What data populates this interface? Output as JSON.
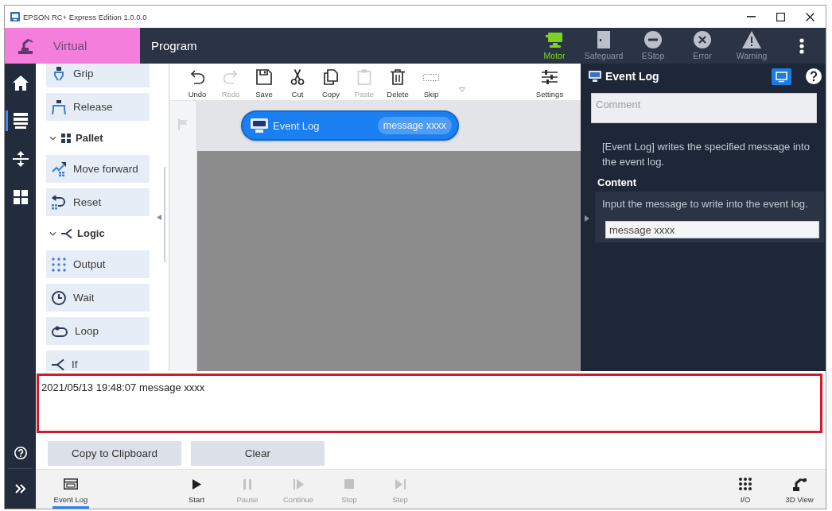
{
  "window": {
    "title": "EPSON RC+ Express Edition 1.0.0.0"
  },
  "header": {
    "controller": "Virtual",
    "page_title": "Program",
    "status": [
      {
        "label": "Motor",
        "active": true
      },
      {
        "label": "Safeguard",
        "active": false
      },
      {
        "label": "EStop",
        "active": false
      },
      {
        "label": "Error",
        "active": false
      },
      {
        "label": "Warning",
        "active": false
      }
    ]
  },
  "nav": {
    "items": [
      {
        "selected": false
      },
      {
        "selected": true
      },
      {
        "selected": false
      },
      {
        "selected": false
      }
    ]
  },
  "palette": {
    "items": [
      {
        "kind": "item",
        "label": "Grip"
      },
      {
        "kind": "item",
        "label": "Release"
      },
      {
        "kind": "group",
        "label": "Pallet",
        "expanded": true,
        "children": [
          {
            "kind": "item",
            "label": "Move forward"
          },
          {
            "kind": "item",
            "label": "Reset"
          }
        ]
      },
      {
        "kind": "group",
        "label": "Logic",
        "expanded": true,
        "children": [
          {
            "kind": "item",
            "label": "Output"
          },
          {
            "kind": "item",
            "label": "Wait"
          },
          {
            "kind": "item",
            "label": "Loop"
          },
          {
            "kind": "item",
            "label": "If"
          }
        ]
      }
    ]
  },
  "toolbar": {
    "items": [
      {
        "label": "Undo",
        "disabled": false
      },
      {
        "label": "Redo",
        "disabled": true
      },
      {
        "label": "Save",
        "disabled": false
      },
      {
        "label": "Cut",
        "disabled": false
      },
      {
        "label": "Copy",
        "disabled": false
      },
      {
        "label": "Paste",
        "disabled": true
      },
      {
        "label": "Delete",
        "disabled": false
      },
      {
        "label": "Skip",
        "disabled": false
      }
    ],
    "settings": "Settings"
  },
  "canvas": {
    "blocks": [
      {
        "title": "Event Log",
        "parameter": "message xxxx"
      }
    ]
  },
  "properties": {
    "title": "Event Log",
    "comment": {
      "placeholder": "Comment"
    },
    "description": "[Event Log] writes the specified message into the event log.",
    "content": {
      "heading": "Content",
      "hint": "Input the message to write into the event log.",
      "value": "message xxxx"
    }
  },
  "log": {
    "highlighted": true,
    "lines": [
      "2021/05/13 19:48:07 message xxxx"
    ]
  },
  "log_buttons": [
    "Copy to Clipboard",
    "Clear"
  ],
  "bottom_bar": {
    "tabs": [
      {
        "label": "Event Log",
        "selected": true
      }
    ],
    "run": [
      {
        "label": "Start",
        "disabled": false
      },
      {
        "label": "Pause",
        "disabled": true
      },
      {
        "label": "Continue",
        "disabled": true
      },
      {
        "label": "Stop",
        "disabled": true
      },
      {
        "label": "Step",
        "disabled": true
      }
    ],
    "tools": [
      {
        "label": "I/O"
      },
      {
        "label": "3D View"
      }
    ]
  }
}
